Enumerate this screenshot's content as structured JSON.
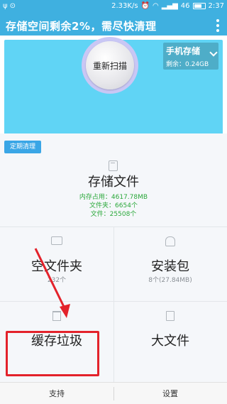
{
  "status_bar": {
    "speed": "2.33K/s",
    "network": "46",
    "time": "2:37"
  },
  "title_bar": {
    "title": "存储空间剩余2%，需尽快清理"
  },
  "hero": {
    "storage_title": "手机存储",
    "storage_remaining": "剩余：0.24GB",
    "scan_button": "重新扫描"
  },
  "content": {
    "tag_label": "定期清理",
    "storage_files": {
      "title": "存储文件",
      "memory": "内存占用：4617.78MB",
      "folders": "文件夹：6654个",
      "files": "文件：25508个"
    },
    "cells": [
      {
        "title": "空文件夹",
        "subtitle": "232个"
      },
      {
        "title": "安装包",
        "subtitle": "8个(27.84MB)"
      },
      {
        "title": "缓存垃圾",
        "subtitle": ""
      },
      {
        "title": "大文件",
        "subtitle": ""
      }
    ]
  },
  "bottom_bar": {
    "support": "支持",
    "settings": "设置"
  },
  "colors": {
    "accent_blue": "#3fb0e0",
    "hero_blue": "#60d4f5",
    "annotation_red": "#e3222b"
  }
}
